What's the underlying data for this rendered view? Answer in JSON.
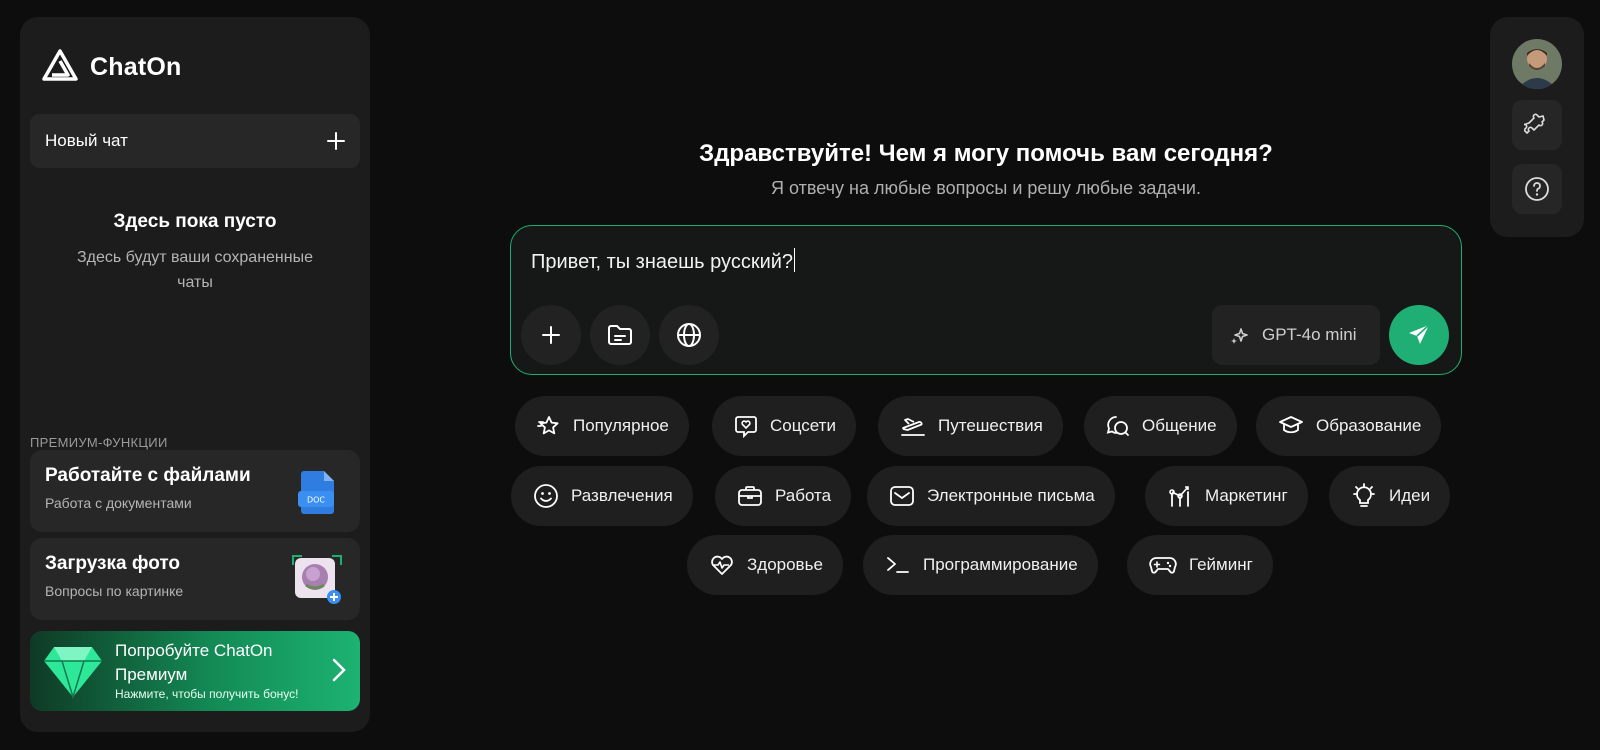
{
  "app": {
    "name": "ChatOn"
  },
  "sidebar": {
    "new_chat_label": "Новый чат",
    "empty_title": "Здесь пока пусто",
    "empty_subtitle": "Здесь будут ваши сохраненные чаты",
    "premium_heading": "ПРЕМИУМ-ФУНКЦИИ",
    "features": [
      {
        "title": "Работайте с файлами",
        "subtitle": "Работа с документами",
        "badge": "DOC"
      },
      {
        "title": "Загрузка фото",
        "subtitle": "Вопросы по картинке"
      }
    ],
    "promo": {
      "title": "Попробуйте ChatOn Премиум",
      "subtitle": "Нажмите, чтобы получить бонус!"
    }
  },
  "main": {
    "greeting": "Здравствуйте! Чем я могу помочь вам сегодня?",
    "subtitle": "Я отвечу на любые вопросы и решу любые задачи.",
    "composer": {
      "text": "Привет, ты знаешь русский?",
      "model": "GPT-4o mini"
    },
    "categories": [
      {
        "label": "Популярное",
        "icon": "star-icon"
      },
      {
        "label": "Соцсети",
        "icon": "heart-chat-icon"
      },
      {
        "label": "Путешествия",
        "icon": "plane-icon"
      },
      {
        "label": "Общение",
        "icon": "chat-bubbles-icon"
      },
      {
        "label": "Образование",
        "icon": "graduation-cap-icon"
      },
      {
        "label": "Развлечения",
        "icon": "smiley-icon"
      },
      {
        "label": "Работа",
        "icon": "briefcase-icon"
      },
      {
        "label": "Электронные письма",
        "icon": "mail-icon"
      },
      {
        "label": "Маркетинг",
        "icon": "marketing-icon"
      },
      {
        "label": "Идеи",
        "icon": "lightbulb-icon"
      },
      {
        "label": "Здоровье",
        "icon": "heart-pulse-icon"
      },
      {
        "label": "Программирование",
        "icon": "terminal-icon"
      },
      {
        "label": "Гейминг",
        "icon": "gamepad-icon"
      }
    ]
  },
  "colors": {
    "accent": "#1fae74",
    "background": "#0d0d0d",
    "panel": "#1c1c1c",
    "chip": "#1f1f1f"
  }
}
